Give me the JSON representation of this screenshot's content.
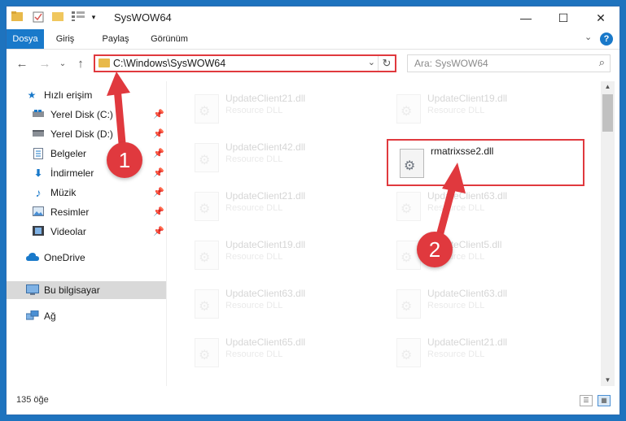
{
  "window": {
    "title": "SysWOW64",
    "minimize": "—",
    "maximize": "☐",
    "close": "✕"
  },
  "ribbon": {
    "tabs": [
      "Dosya",
      "Giriş",
      "Paylaş",
      "Görünüm"
    ],
    "active_tab": "Dosya",
    "expand": "⌄",
    "help": "?"
  },
  "nav": {
    "back": "←",
    "forward": "→",
    "recent": "⌄",
    "up": "↑",
    "address": "C:\\Windows\\SysWOW64",
    "address_dropdown": "⌄",
    "refresh": "↻",
    "search_placeholder": "Ara: SysWOW64",
    "search_icon": "⌕"
  },
  "sidebar": {
    "quick_access": "Hızlı erişim",
    "pin": "📌",
    "items": [
      {
        "label": "Yerel Disk (C:)",
        "icon": "drive-icon",
        "pinned": true
      },
      {
        "label": "Yerel Disk (D:)",
        "icon": "drive-icon",
        "pinned": true
      },
      {
        "label": "Belgeler",
        "icon": "documents-icon",
        "pinned": true
      },
      {
        "label": "İndirmeler",
        "icon": "download-icon",
        "pinned": true
      },
      {
        "label": "Müzik",
        "icon": "music-icon",
        "pinned": true
      },
      {
        "label": "Resimler",
        "icon": "pictures-icon",
        "pinned": true
      },
      {
        "label": "Videolar",
        "icon": "videos-icon",
        "pinned": true
      }
    ],
    "onedrive": "OneDrive",
    "this_pc": "Bu bilgisayar",
    "network": "Ağ"
  },
  "files": [
    {
      "name": "UpdateClient21.dll",
      "desc": "Resource DLL"
    },
    {
      "name": "UpdateClient19.dll",
      "desc": "Resource DLL"
    },
    {
      "name": "UpdateClient42.dll",
      "desc": "Resource DLL"
    },
    {
      "name": "rmatrixsse2.dll",
      "desc": ""
    },
    {
      "name": "UpdateClient21.dll",
      "desc": "Resource DLL"
    },
    {
      "name": "UpdateClient63.dll",
      "desc": "Resource DLL"
    },
    {
      "name": "UpdateClient19.dll",
      "desc": "Resource DLL"
    },
    {
      "name": "UpdateClient5.dll",
      "desc": "Resource DLL"
    },
    {
      "name": "UpdateClient63.dll",
      "desc": "Resource DLL"
    },
    {
      "name": "UpdateClient63.dll",
      "desc": "Resource DLL"
    },
    {
      "name": "UpdateClient65.dll",
      "desc": "Resource DLL"
    },
    {
      "name": "UpdateClient21.dll",
      "desc": "Resource DLL"
    }
  ],
  "status": {
    "count": "135 öğe"
  },
  "annotations": {
    "step1": "1",
    "step2": "2",
    "color": "#e0393e"
  }
}
